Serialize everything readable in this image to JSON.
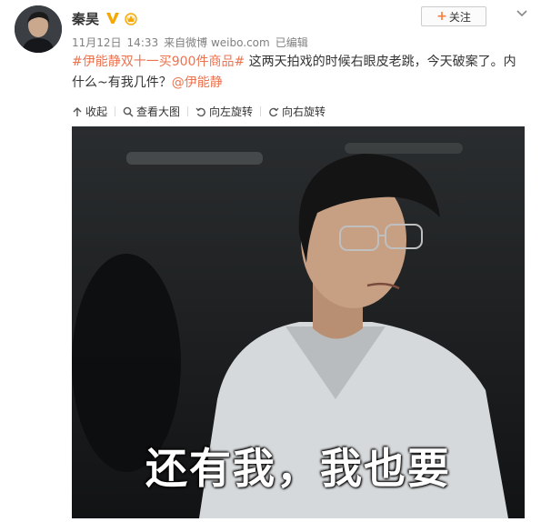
{
  "author": {
    "name": "秦昊",
    "vip_icon": "v-verified-badge-icon",
    "member_icon": "member-crown-icon"
  },
  "post": {
    "date": "11月12日",
    "time": "14:33",
    "source_prefix": "来自",
    "source": "微博 weibo.com",
    "edited": "已编辑",
    "topic": "#伊能静双十一买900件商品#",
    "text_main": " 这两天拍戏的时候右眼皮老跳，今天破案了。内什么~有我几件？",
    "mention": "@伊能静"
  },
  "actions": {
    "follow_label": "关注",
    "menu_icon": "chevron-down-icon"
  },
  "toolbar": {
    "collapse": "收起",
    "view_large": "查看大图",
    "rotate_left": "向左旋转",
    "rotate_right": "向右旋转"
  },
  "image": {
    "caption": "还有我，我也要"
  },
  "colors": {
    "link": "#eb7350",
    "meta": "#808080",
    "follow_plus": "#fa7d3c",
    "vip": "#f7a800"
  }
}
